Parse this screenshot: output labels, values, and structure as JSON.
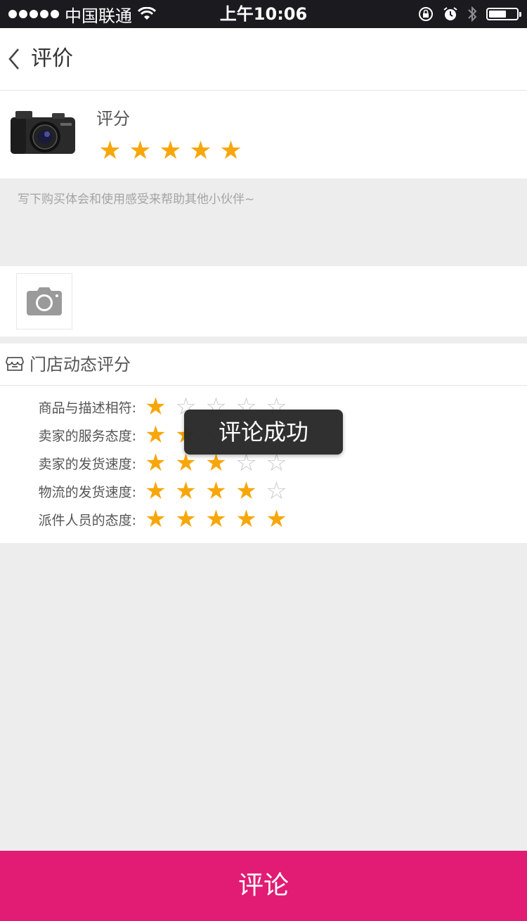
{
  "status_bar": {
    "carrier": "中国联通",
    "time": "上午10:06",
    "battery_level": 0.62
  },
  "nav": {
    "title": "评价"
  },
  "product": {
    "rating_label": "评分",
    "rating": 5,
    "max_rating": 5
  },
  "review": {
    "placeholder": "写下购买体会和使用感受来帮助其他小伙伴~"
  },
  "store": {
    "title": "门店动态评分",
    "ratings": [
      {
        "label": "商品与描述相符:",
        "value": 1
      },
      {
        "label": "卖家的服务态度:",
        "value": 2
      },
      {
        "label": "卖家的发货速度:",
        "value": 3
      },
      {
        "label": "物流的发货速度:",
        "value": 4
      },
      {
        "label": "派件人员的态度:",
        "value": 5
      }
    ],
    "max_rating": 5
  },
  "toast": {
    "message": "评论成功"
  },
  "submit": {
    "label": "评论"
  },
  "colors": {
    "accent": "#e21b74",
    "star_filled": "#f7a70a",
    "star_empty": "#c9c9c9"
  },
  "icons": {
    "back": "chevron-left-icon",
    "camera": "camera-icon",
    "store": "store-icon"
  }
}
